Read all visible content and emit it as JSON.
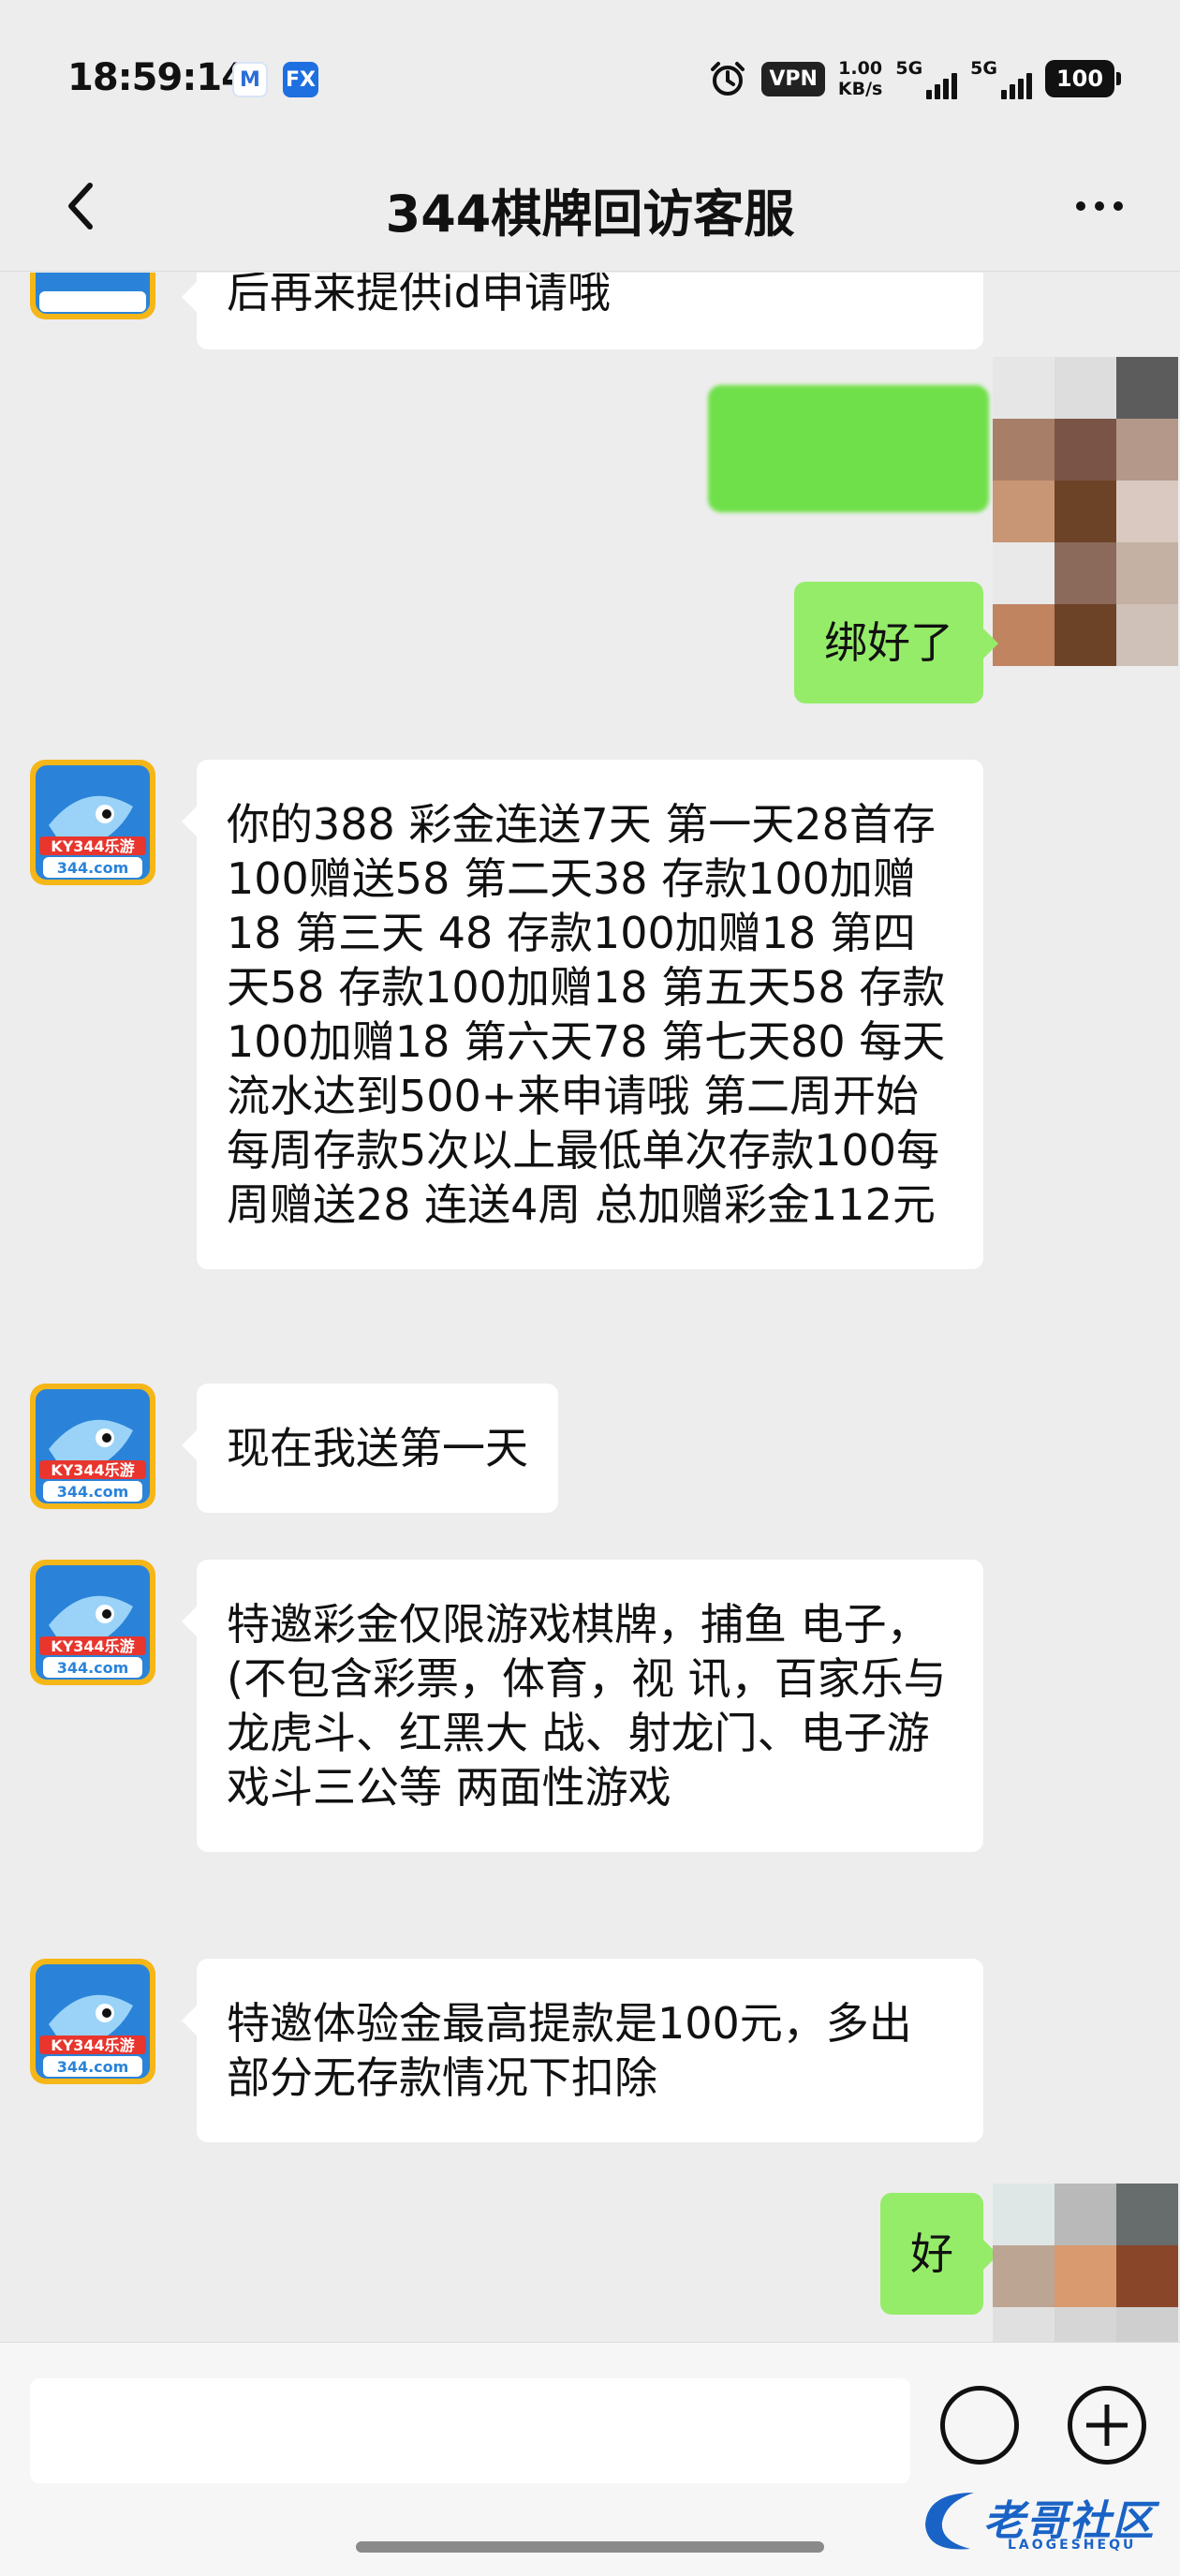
{
  "status_bar": {
    "time": "18:59:14",
    "app_icons": [
      "M",
      "FX"
    ],
    "vpn": "VPN",
    "speed_value": "1.00",
    "speed_unit": "KB/s",
    "network_1": "5G",
    "network_2": "5G",
    "battery": "100"
  },
  "header": {
    "title": "344棋牌回访客服",
    "back_icon": "chevron-left-icon",
    "more_icon": "more-dots-icon"
  },
  "messages": [
    {
      "side": "in",
      "text": "后再来提供id申请哦"
    },
    {
      "side": "out",
      "type": "image",
      "note": "redacted"
    },
    {
      "side": "out",
      "text": "绑好了"
    },
    {
      "side": "in",
      "text": "你的388 彩金连送7天 第一天28首存100赠送58 第二天38 存款100加赠18 第三天 48 存款100加赠18 第四天58 存款100加赠18 第五天58 存款100加赠18 第六天78 第七天80 每天流水达到500+来申请哦 第二周开始每周存款5次以上最低单次存款100每周赠送28 连送4周 总加赠彩金112元"
    },
    {
      "side": "in",
      "text": "现在我送第一天"
    },
    {
      "side": "in",
      "text": "特邀彩金仅限游戏棋牌，捕鱼 电子，(不包含彩票，体育，视 讯，百家乐与龙虎斗、红黑大 战、射龙门、电子游戏斗三公等 两面性游戏"
    },
    {
      "side": "in",
      "text": "特邀体验金最高提款是100元，多出部分无存款情况下扣除"
    },
    {
      "side": "out",
      "text": "好"
    }
  ],
  "avatar": {
    "brand": "KY344乐游",
    "domain": "344.com"
  },
  "input_bar": {
    "emoji_icon": "emoji-icon",
    "plus_icon": "plus-icon"
  },
  "watermark": {
    "text": "老哥社区",
    "sub": "LAOGESHEQU"
  },
  "colors": {
    "background": "#ededed",
    "outgoing_bubble": "#95ec69",
    "incoming_bubble": "#ffffff"
  }
}
